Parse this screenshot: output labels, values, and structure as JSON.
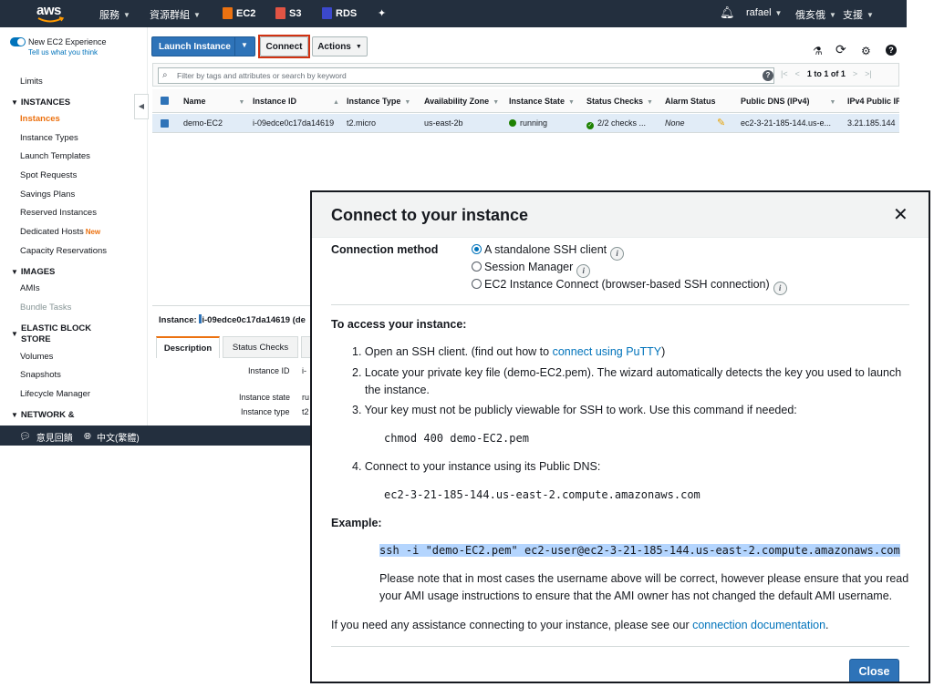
{
  "topnav": {
    "services": "服務",
    "resource_groups": "資源群組",
    "ec2": "EC2",
    "s3": "S3",
    "rds": "RDS",
    "user": "rafael",
    "region": "俄亥俄",
    "support": "支援",
    "logo": "aws"
  },
  "sidebar": {
    "new_experience": "New EC2 Experience",
    "tell_us": "Tell us what you think",
    "limits": "Limits",
    "instances_head": "INSTANCES",
    "instances": "Instances",
    "instance_types": "Instance Types",
    "launch_templates": "Launch Templates",
    "spot_requests": "Spot Requests",
    "savings_plans": "Savings Plans",
    "reserved_instances": "Reserved Instances",
    "dedicated_hosts": "Dedicated Hosts",
    "new_tag": "New",
    "capacity_reservations": "Capacity Reservations",
    "images_head": "IMAGES",
    "amis": "AMIs",
    "bundle_tasks": "Bundle Tasks",
    "ebs_head_1": "ELASTIC BLOCK",
    "ebs_head_2": "STORE",
    "volumes": "Volumes",
    "snapshots": "Snapshots",
    "lifecycle_manager": "Lifecycle Manager",
    "network_head": "NETWORK &"
  },
  "toolbar": {
    "launch_instance": "Launch Instance",
    "connect": "Connect",
    "actions": "Actions"
  },
  "search": {
    "placeholder": "Filter by tags and attributes or search by keyword",
    "pager": "1 to 1 of 1"
  },
  "table": {
    "headers": [
      "Name",
      "Instance ID",
      "Instance Type",
      "Availability Zone",
      "Instance State",
      "Status Checks",
      "Alarm Status",
      "Public DNS (IPv4)",
      "IPv4 Public IP"
    ],
    "row": {
      "name": "demo-EC2",
      "instance_id": "i-09edce0c17da14619",
      "instance_type": "t2.micro",
      "az": "us-east-2b",
      "state": "running",
      "status_checks": "2/2 checks ...",
      "alarm": "None",
      "public_dns": "ec2-3-21-185-144.us-e...",
      "public_ip": "3.21.185.144"
    }
  },
  "details": {
    "label": "Instance:",
    "instance": "i-09edce0c17da14619 (de",
    "tab_description": "Description",
    "tab_status_checks": "Status Checks",
    "field_instance_id": "Instance ID",
    "field_instance_state": "Instance state",
    "field_instance_type": "Instance type",
    "val_instance_id": "i-",
    "val_instance_state": "ru",
    "val_instance_type": "t2"
  },
  "footer": {
    "feedback": "意見回饋",
    "language": "中文(繁體)"
  },
  "modal": {
    "title": "Connect to your instance",
    "connection_method": "Connection method",
    "opt_ssh": "A standalone SSH client",
    "opt_session": "Session Manager",
    "opt_ec2ic": "EC2 Instance Connect (browser-based SSH connection)",
    "access_head": "To access your instance:",
    "step1": "1. Open an SSH client. (find out how to",
    "step1_link": "connect using PuTTY",
    "step1_end": ")",
    "step2a": "2. Locate your private key file (demo-EC2.pem). The wizard automatically detects the key you used to launch",
    "step2b": "the instance.",
    "step3": "3. Your key must not be publicly viewable for SSH to work. Use this command if needed:",
    "chmod_cmd": "chmod 400 demo-EC2.pem",
    "step4": "4. Connect to your instance using its Public DNS:",
    "dns": "ec2-3-21-185-144.us-east-2.compute.amazonaws.com",
    "example_head": "Example:",
    "ssh_cmd": "ssh -i \"demo-EC2.pem\" ec2-user@ec2-3-21-185-144.us-east-2.compute.amazonaws.com",
    "note_a": "Please note that in most cases the username above will be correct, however please ensure that you read",
    "note_b": "your AMI usage instructions to ensure that the AMI owner has not changed the default AMI username.",
    "assist": "If you need any assistance connecting to your instance, please see our",
    "assist_link": "connection documentation",
    "assist_end": ".",
    "close": "Close"
  }
}
